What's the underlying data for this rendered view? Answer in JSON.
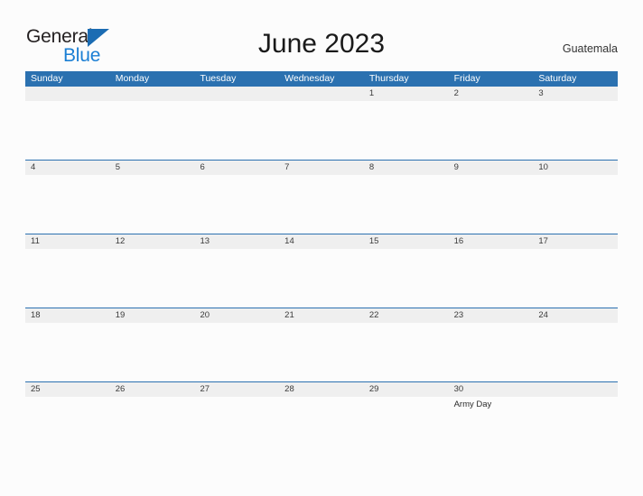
{
  "brand": {
    "name_part1": "General",
    "name_part2": "Blue",
    "flag_icon": "blue-triangle-flag",
    "accent_color": "#1b7fd4"
  },
  "header": {
    "title": "June 2023",
    "locale": "Guatemala"
  },
  "colors": {
    "header_blue": "#2b71b0",
    "date_band_gray": "#efefef",
    "page_background": "#fcfcfc",
    "text": "#2b2b2b"
  },
  "calendar": {
    "month": "June",
    "year": "2023",
    "weekday_headers": [
      "Sunday",
      "Monday",
      "Tuesday",
      "Wednesday",
      "Thursday",
      "Friday",
      "Saturday"
    ],
    "weeks": [
      {
        "days": [
          {
            "num": "",
            "events": []
          },
          {
            "num": "",
            "events": []
          },
          {
            "num": "",
            "events": []
          },
          {
            "num": "",
            "events": []
          },
          {
            "num": "1",
            "events": []
          },
          {
            "num": "2",
            "events": []
          },
          {
            "num": "3",
            "events": []
          }
        ]
      },
      {
        "days": [
          {
            "num": "4",
            "events": []
          },
          {
            "num": "5",
            "events": []
          },
          {
            "num": "6",
            "events": []
          },
          {
            "num": "7",
            "events": []
          },
          {
            "num": "8",
            "events": []
          },
          {
            "num": "9",
            "events": []
          },
          {
            "num": "10",
            "events": []
          }
        ]
      },
      {
        "days": [
          {
            "num": "11",
            "events": []
          },
          {
            "num": "12",
            "events": []
          },
          {
            "num": "13",
            "events": []
          },
          {
            "num": "14",
            "events": []
          },
          {
            "num": "15",
            "events": []
          },
          {
            "num": "16",
            "events": []
          },
          {
            "num": "17",
            "events": []
          }
        ]
      },
      {
        "days": [
          {
            "num": "18",
            "events": []
          },
          {
            "num": "19",
            "events": []
          },
          {
            "num": "20",
            "events": []
          },
          {
            "num": "21",
            "events": []
          },
          {
            "num": "22",
            "events": []
          },
          {
            "num": "23",
            "events": []
          },
          {
            "num": "24",
            "events": []
          }
        ]
      },
      {
        "days": [
          {
            "num": "25",
            "events": []
          },
          {
            "num": "26",
            "events": []
          },
          {
            "num": "27",
            "events": []
          },
          {
            "num": "28",
            "events": []
          },
          {
            "num": "29",
            "events": []
          },
          {
            "num": "30",
            "events": [
              "Army Day"
            ]
          },
          {
            "num": "",
            "events": []
          }
        ]
      }
    ]
  }
}
